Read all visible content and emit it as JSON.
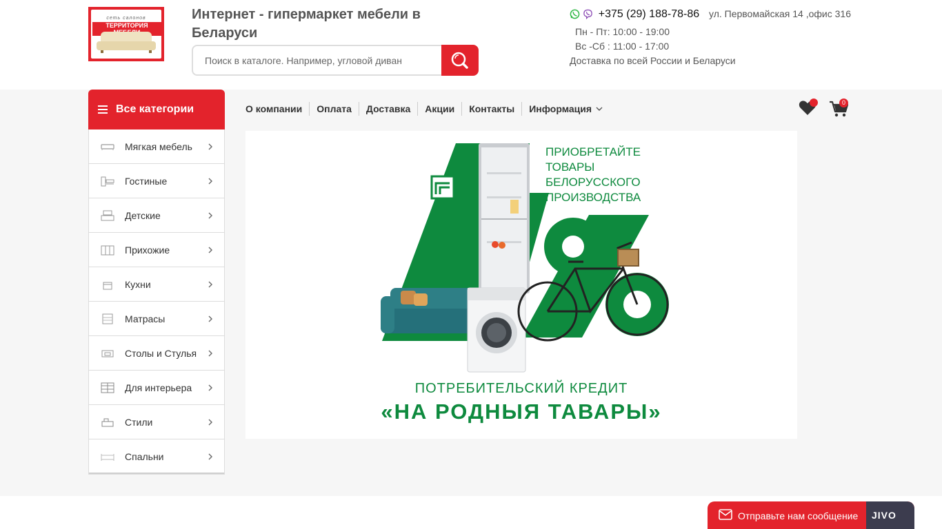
{
  "header": {
    "logo_small_text": "сеть салонов",
    "logo_brand": "ТЕРРИТОРИЯ МЕБЕЛИ",
    "title": "Интернет - гипермаркет мебели в Беларуси",
    "search_placeholder": "Поиск в каталоге. Например, угловой диван",
    "phone": "+375 (29) 188-78-86",
    "address": "ул. Первомайская 14 ,офис 316",
    "hours_weekdays": "Пн - Пт: 10:00 - 19:00",
    "hours_weekend": "Вс -Сб : 11:00 - 17:00",
    "delivery": "Доставка по всей России и Беларуси"
  },
  "sidebar": {
    "header": "Все категории",
    "items": [
      {
        "label": "Мягкая мебель",
        "icon": "sofa-icon"
      },
      {
        "label": "Гостиные",
        "icon": "living-room-icon"
      },
      {
        "label": "Детские",
        "icon": "kids-furniture-icon"
      },
      {
        "label": "Прихожие",
        "icon": "hallway-icon"
      },
      {
        "label": "Кухни",
        "icon": "kitchen-icon"
      },
      {
        "label": "Матрасы",
        "icon": "mattress-icon"
      },
      {
        "label": "Столы и Стулья",
        "icon": "table-chair-icon"
      },
      {
        "label": "Для интерьера",
        "icon": "interior-icon"
      },
      {
        "label": "Стили",
        "icon": "styles-icon"
      },
      {
        "label": "Спальни",
        "icon": "bed-icon"
      }
    ]
  },
  "nav": {
    "items": [
      "О компании",
      "Оплата",
      "Доставка",
      "Акции",
      "Контакты",
      "Информация"
    ]
  },
  "cart": {
    "count": "0"
  },
  "banner": {
    "headline_lines": [
      "ПРИОБРЕТАЙТЕ",
      "ТОВАРЫ",
      "БЕЛОРУССКОГО",
      "ПРОИЗВОДСТВА"
    ],
    "rate": "4%",
    "subtitle": "ПОТРЕБИТЕЛЬСКИЙ КРЕДИТ",
    "slogan": "«НА РОДНЫЯ ТАВАРЫ»"
  },
  "chat": {
    "label": "Отправьте нам сообщение",
    "brand": "JIVO"
  },
  "colors": {
    "accent": "#e3232c",
    "banner_green": "#0e8a3e"
  }
}
